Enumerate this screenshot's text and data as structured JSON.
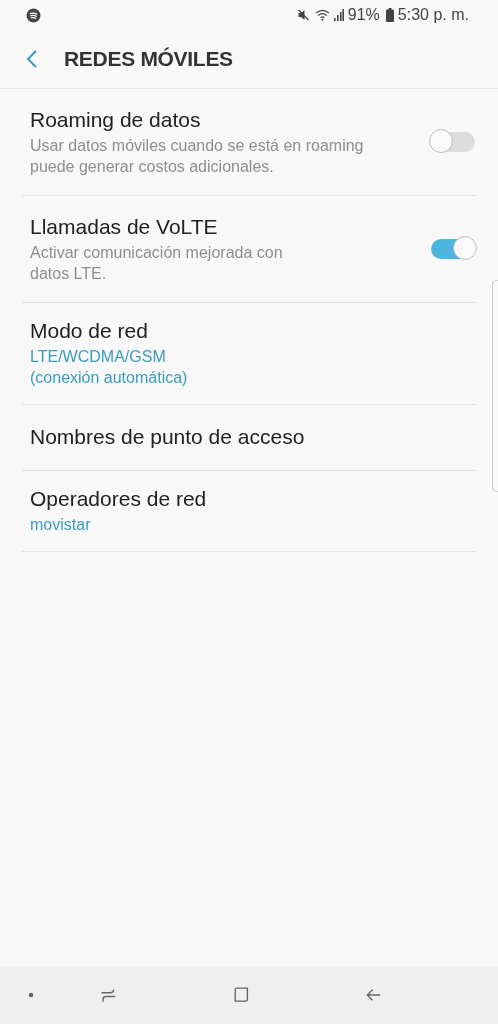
{
  "status_bar": {
    "battery": "91%",
    "time": "5:30 p. m."
  },
  "header": {
    "title": "REDES MÓVILES"
  },
  "items": [
    {
      "kind": "toggle",
      "title": "Roaming de datos",
      "summary": "Usar datos móviles cuando se está en roaming puede generar costos adicionales.",
      "on": false
    },
    {
      "kind": "toggle",
      "title": "Llamadas de VoLTE",
      "summary": "Activar comunicación mejorada con datos LTE.",
      "on": true
    },
    {
      "kind": "value",
      "title": "Modo de red",
      "summary": "LTE/WCDMA/GSM (conexión automática)"
    },
    {
      "kind": "plain",
      "title": "Nombres de punto de acceso"
    },
    {
      "kind": "value",
      "title": "Operadores de red",
      "summary": "movistar"
    }
  ]
}
